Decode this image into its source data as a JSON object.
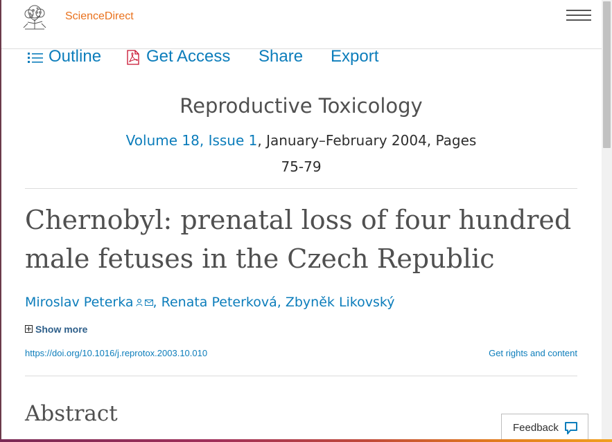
{
  "header": {
    "brand": "ScienceDirect",
    "menu_icon": "hamburger-menu-icon",
    "logo": "elsevier-tree-logo"
  },
  "toolbar": {
    "outline_label": "Outline",
    "outline_icon": "list-icon",
    "get_access_label": "Get Access",
    "get_access_icon": "pdf-icon",
    "share_label": "Share",
    "export_label": "Export"
  },
  "publication": {
    "journal": "Reproductive Toxicology",
    "volume_issue": "Volume 18, Issue 1",
    "date_pages": ", January–February 2004, Pages",
    "pages": "75-79"
  },
  "article": {
    "title": "Chernobyl: prenatal loss of four hundred male fetuses in the Czech Republic",
    "authors": [
      {
        "name": "Miroslav Peterka",
        "icons": [
          "person-icon",
          "envelope-icon"
        ]
      },
      {
        "name": "Renata Peterková"
      },
      {
        "name": "Zbyněk Likovský"
      }
    ],
    "separator": ",",
    "show_more": "Show more",
    "doi": "https://doi.org/10.1016/j.reprotox.2003.10.010",
    "rights": "Get rights and content"
  },
  "sections": {
    "abstract_heading": "Abstract"
  },
  "feedback": {
    "label": "Feedback",
    "icon": "speech-bubble-icon"
  },
  "colors": {
    "link": "#0c7dbb",
    "brand": "#e9711c",
    "heading": "#505050"
  }
}
